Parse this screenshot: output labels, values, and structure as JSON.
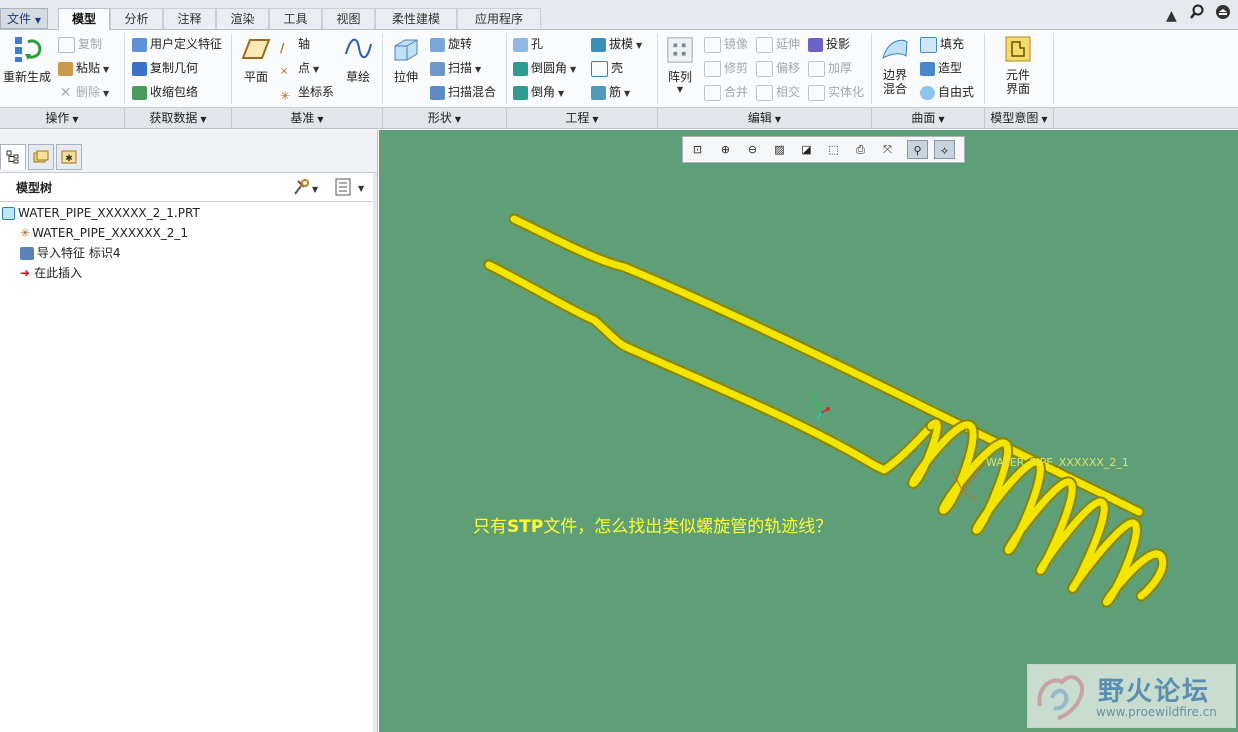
{
  "menu": {
    "file": "文件",
    "tabs": [
      "模型",
      "分析",
      "注释",
      "渲染",
      "工具",
      "视图",
      "柔性建模",
      "应用程序"
    ],
    "active_tab": "模型"
  },
  "ribbon": {
    "ops": {
      "regen": "重新生成",
      "copy": "复制",
      "paste": "粘贴",
      "delete": "删除"
    },
    "getdata": {
      "udf": "用户定义特征",
      "copygeom": "复制几何",
      "shrinkwrap": "收缩包络"
    },
    "datum": {
      "plane": "平面",
      "axis": "轴",
      "point": "点",
      "csys": "坐标系",
      "sketch": "草绘"
    },
    "shape": {
      "extrude": "拉伸",
      "revolve": "旋转",
      "sweep": "扫描",
      "swept_blend": "扫描混合"
    },
    "eng": {
      "hole": "孔",
      "round": "倒圆角",
      "chamfer": "倒角",
      "draft": "拔模",
      "shell": "壳",
      "rib": "筋"
    },
    "edit": {
      "pattern": "阵列",
      "mirror": "镜像",
      "trim": "修剪",
      "merge": "合并",
      "extend": "延伸",
      "offset": "偏移",
      "intersect": "相交",
      "project": "投影",
      "thicken": "加厚",
      "solidify": "实体化"
    },
    "surface": {
      "boundary_line1": "边界",
      "boundary_line2": "混合",
      "fill": "填充",
      "style": "造型",
      "freestyle": "自由式"
    },
    "intent": {
      "comp_line1": "元件",
      "comp_line2": "界面"
    }
  },
  "groups": [
    "操作",
    "获取数据",
    "基准",
    "形状",
    "工程",
    "编辑",
    "曲面",
    "模型意图"
  ],
  "tree": {
    "title": "模型树",
    "items": [
      "WATER_PIPE_XXXXXX_2_1.PRT",
      "WATER_PIPE_XXXXXX_2_1",
      "导入特征 标识4",
      "在此插入"
    ]
  },
  "graphics": {
    "question_pre": "只有",
    "question_stp": "STP",
    "question_post": "文件，怎么找出类似螺旋管的轨迹线？",
    "model_label": "WATER_PIPE_XXXXXX_2_1"
  },
  "watermark": {
    "title": "野火论坛",
    "url": "www.proewildfire.cn"
  },
  "colors": {
    "graphics_bg": "#5f9f78",
    "pipe": "#f2e600",
    "question": "#ffff33"
  }
}
